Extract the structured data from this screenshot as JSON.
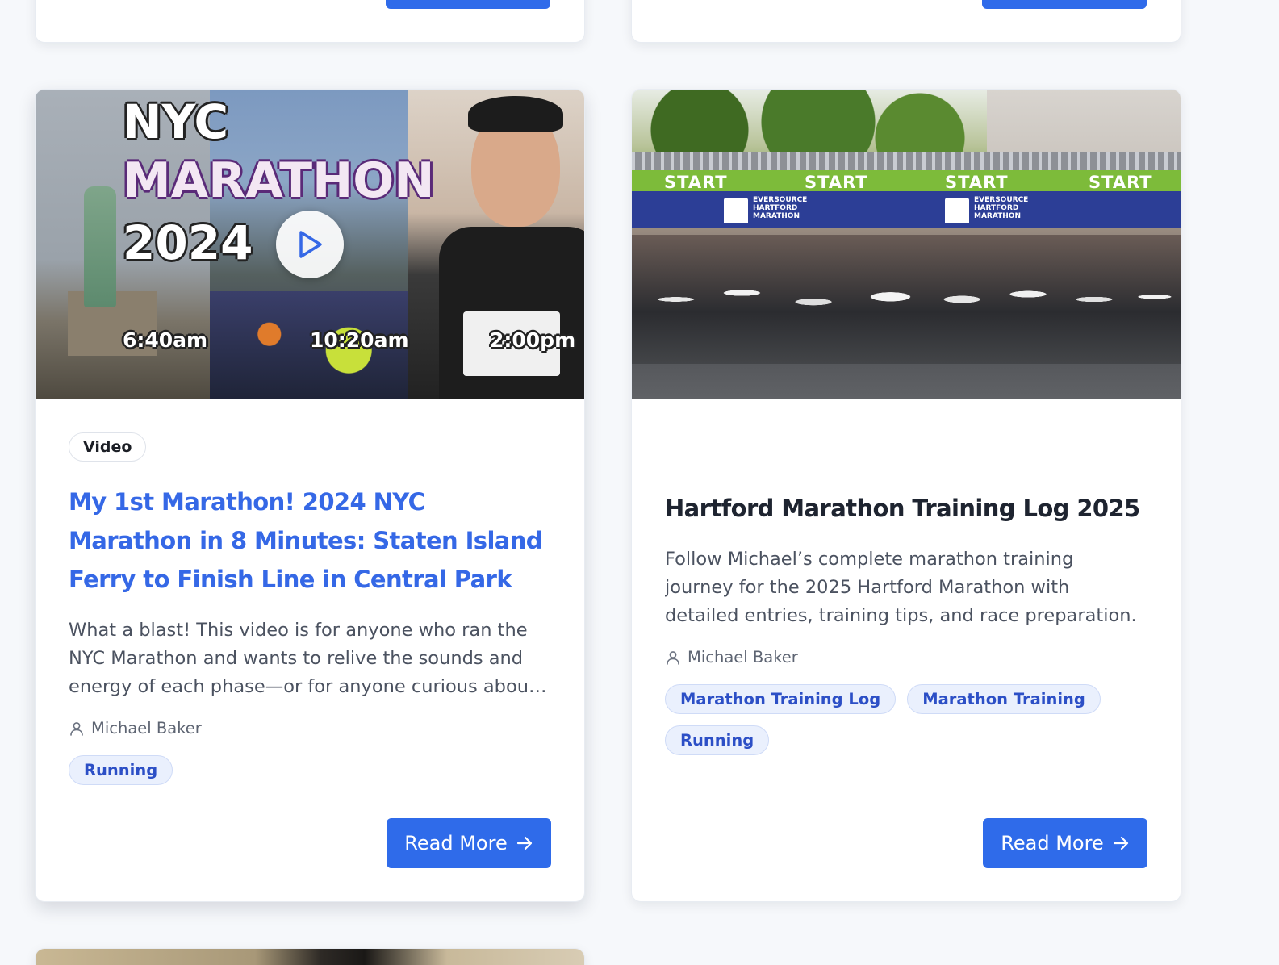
{
  "cards": [
    {
      "type_label": "Video",
      "title": "My 1st Marathon! 2024 NYC Marathon in 8 Minutes: Staten Island Ferry to Finish Line in Central Park",
      "excerpt": "What a blast! This video is for anyone who ran the NYC Marathon and wants to relive the sounds and energy of each phase—or for anyone curious about what it's like.",
      "author": "Michael Baker",
      "tags": [
        "Running"
      ],
      "read_more_label": "Read More",
      "thumbnail": {
        "line1": "NYC",
        "line2": "MARATHON",
        "line3": "2024",
        "time1": "6:40am",
        "time2": "10:20am",
        "time3": "2:00pm",
        "play_icon": "play-icon"
      }
    },
    {
      "title": "Hartford Marathon Training Log 2025",
      "excerpt": "Follow Michael’s complete marathon training journey for the 2025 Hartford Marathon with detailed entries, training tips, and race preparation.",
      "author": "Michael Baker",
      "tags": [
        "Marathon Training Log",
        "Marathon Training",
        "Running"
      ],
      "read_more_label": "Read More",
      "thumbnail": {
        "banner_word": "START",
        "logo_line1": "EVERSOURCE",
        "logo_line2": "HARTFORD",
        "logo_line3": "MARATHON"
      }
    }
  ],
  "colors": {
    "accent": "#2f6bea",
    "title_link": "#3568e6",
    "tag_text": "#2c4fc6",
    "tag_bg": "#eaf0fd",
    "page_bg": "#f6f8fb"
  }
}
